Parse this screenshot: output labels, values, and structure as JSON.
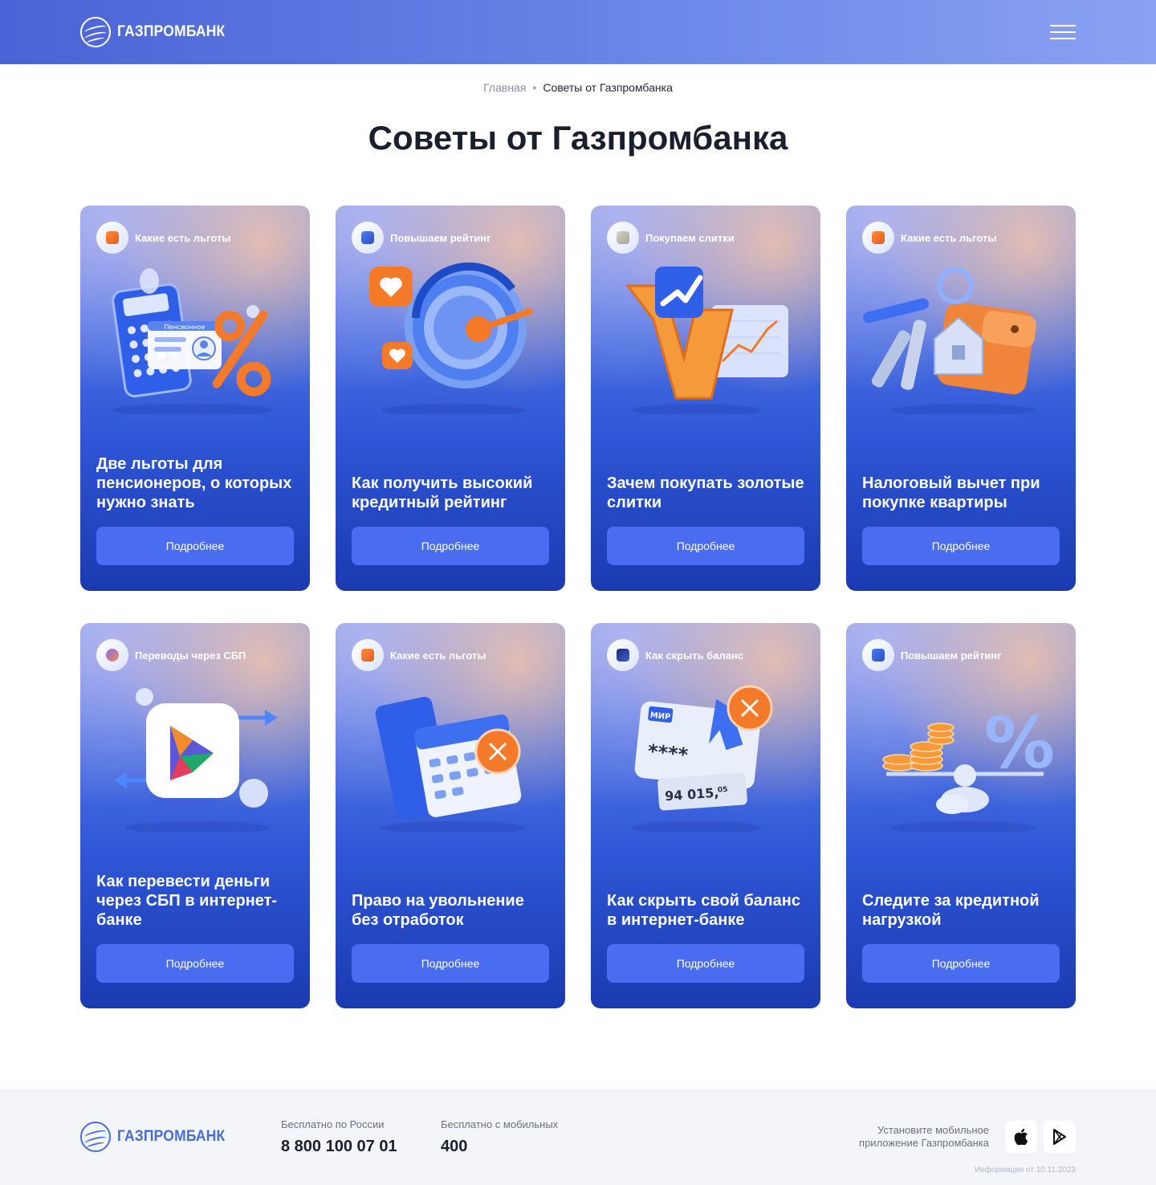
{
  "header": {
    "logo_text": "ГАЗПРОМБАНК"
  },
  "breadcrumb": {
    "home": "Главная",
    "separator": "•",
    "current": "Советы от Газпромбанка"
  },
  "page_title": "Советы от Газпромбанка",
  "cards": [
    {
      "tag": "Какие есть льготы",
      "title": "Две льготы для пенсионеров, о которых нужно знать",
      "button": "Подробнее",
      "illustration_badge": "Пенсионное"
    },
    {
      "tag": "Повышаем рейтинг",
      "title": "Как получить высокий кредитный рейтинг",
      "button": "Подробнее"
    },
    {
      "tag": "Покупаем слитки",
      "title": "Зачем покупать золотые слитки",
      "button": "Подробнее"
    },
    {
      "tag": "Какие есть льготы",
      "title": "Налоговый вычет при покупке квартиры",
      "button": "Подробнее"
    },
    {
      "tag": "Переводы через СБП",
      "title": "Как перевести деньги через СБП в интернет-банке",
      "button": "Подробнее"
    },
    {
      "tag": "Какие есть льготы",
      "title": "Право на увольнение без отработок",
      "button": "Подробнее"
    },
    {
      "tag": "Как скрыть баланс",
      "title": "Как скрыть свой баланс в интернет-банке",
      "button": "Подробнее",
      "card_brand": "МИР",
      "masked_digits": "****",
      "balance": "94 015,",
      "balance_cents": "05"
    },
    {
      "tag": "Повышаем рейтинг",
      "title": "Следите за кредитной нагрузкой",
      "button": "Подробнее",
      "illustration_symbol": "%"
    }
  ],
  "footer": {
    "logo_text": "ГАЗПРОМБАНК",
    "phone_russia_label": "Бесплатно по России",
    "phone_russia": "8 800 100 07 01",
    "phone_mobile_label": "Бесплатно с мобильных",
    "phone_mobile": "400",
    "app_text": "Установите мобильное приложение Газпромбанка",
    "info_date": "Информация от 10.11.2023",
    "store_icons": [
      "apple-icon",
      "google-play-icon"
    ]
  },
  "colors": {
    "header_gradient_start": "#4a63d6",
    "header_gradient_end": "#8aa2f3",
    "button": "#4a6cf0",
    "card_bottom": "#1a3ab0",
    "accent_orange": "#f47a2a"
  }
}
